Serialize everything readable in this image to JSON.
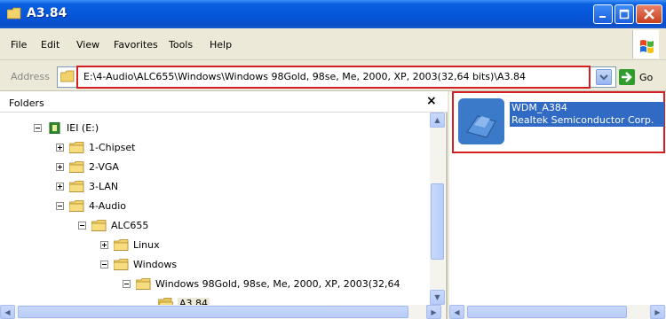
{
  "window": {
    "title": "A3.84"
  },
  "menu": [
    "File",
    "Edit",
    "View",
    "Favorites",
    "Tools",
    "Help"
  ],
  "address": {
    "label": "Address",
    "value": "E:\\4-Audio\\ALC655\\Windows\\Windows 98Gold, 98se, Me, 2000, XP, 2003(32,64 bits)\\A3.84",
    "go_label": "Go"
  },
  "folders": {
    "title": "Folders",
    "close": "×",
    "tree": [
      {
        "label": "IEI (E:)",
        "toggle": "minus",
        "icon": "drive-icon",
        "level": 0
      },
      {
        "label": "1-Chipset",
        "toggle": "plus",
        "icon": "folder-icon",
        "level": 1
      },
      {
        "label": "2-VGA",
        "toggle": "plus",
        "icon": "folder-icon",
        "level": 1
      },
      {
        "label": "3-LAN",
        "toggle": "plus",
        "icon": "folder-icon",
        "level": 1
      },
      {
        "label": "4-Audio",
        "toggle": "minus",
        "icon": "folder-icon",
        "level": 1
      },
      {
        "label": "ALC655",
        "toggle": "minus",
        "icon": "folder-icon",
        "level": 2
      },
      {
        "label": "Linux",
        "toggle": "plus",
        "icon": "folder-icon",
        "level": 3
      },
      {
        "label": "Windows",
        "toggle": "minus",
        "icon": "folder-icon",
        "level": 3
      },
      {
        "label": "Windows 98Gold, 98se, Me, 2000, XP, 2003(32,64",
        "toggle": "minus",
        "icon": "folder-icon",
        "level": 4
      },
      {
        "label": "A3.84",
        "toggle": "none",
        "icon": "open-folder-icon",
        "level": 5,
        "selected": true
      }
    ]
  },
  "files": [
    {
      "name": "WDM_A384",
      "company": "Realtek Semiconductor Corp.",
      "icon": "setup-icon"
    }
  ]
}
